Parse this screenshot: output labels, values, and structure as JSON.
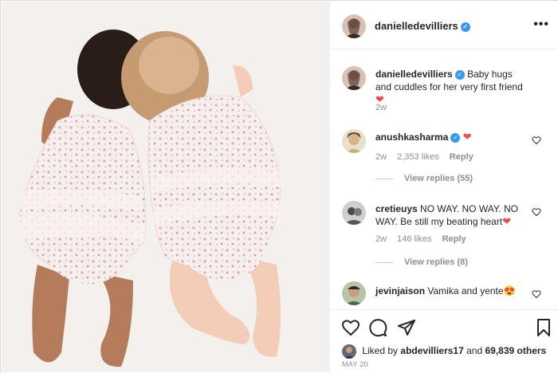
{
  "post": {
    "username": "danielledevilliers",
    "more_icon": "more-horizontal-icon",
    "caption": {
      "username": "danielledevilliers",
      "text": "Baby hugs and cuddles for her very first friend",
      "emoji": "❤",
      "time": "2w"
    },
    "comments": [
      {
        "username": "anushkasharma",
        "text": "",
        "emoji": "❤",
        "time": "2w",
        "likes": "2,353 likes",
        "reply": "Reply",
        "view_replies": "View replies (55)"
      },
      {
        "username": "cretieuys",
        "text": "NO WAY. NO WAY. NO WAY. Be still my beating heart",
        "emoji": "❤",
        "time": "2w",
        "likes": "146 likes",
        "reply": "Reply",
        "view_replies": "View replies (8)"
      },
      {
        "username": "jevinjaison",
        "text": "Vamika and yente",
        "emoji": "😍"
      }
    ],
    "liked_by": {
      "prefix": "Liked by",
      "user": "abdevilliers17",
      "middle": "and",
      "others": "69,839 others"
    },
    "date": "MAY 20"
  },
  "colors": {
    "verified": "#3897f0",
    "heart": "#ed4956",
    "muted": "#8e8e8e"
  }
}
